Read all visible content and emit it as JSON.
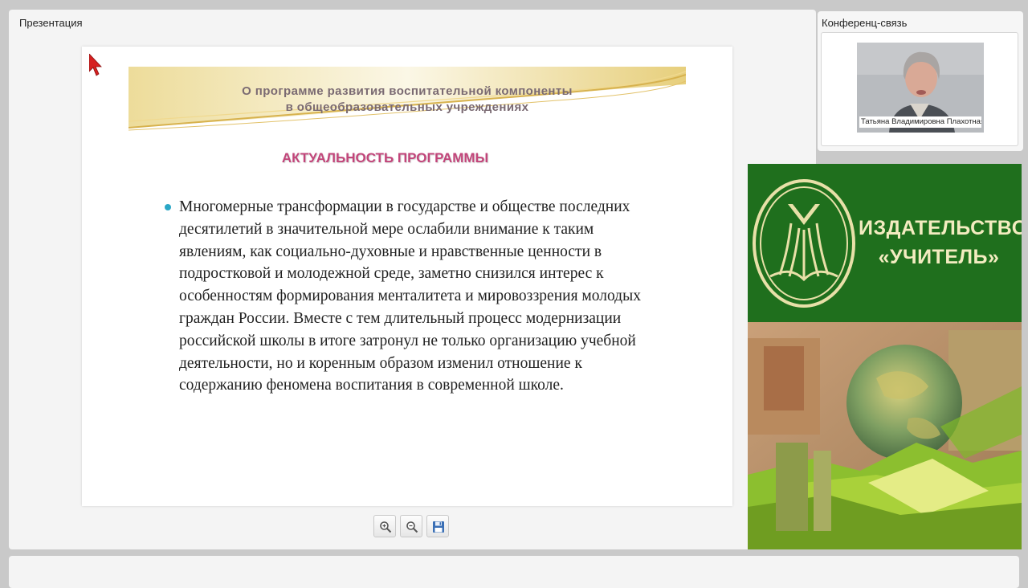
{
  "presentation": {
    "panel_title": "Презентация",
    "slide": {
      "banner_line1": "О программе развития воспитательной компоненты",
      "banner_line2": "в общеобразовательных учреждениях",
      "heading": "АКТУАЛЬНОСТЬ ПРОГРАММЫ",
      "body": "Многомерные трансформации в государстве и обществе последних десятилетий в значительной мере ослабили внимание к таким явлениям, как социально-духовные и нравственные ценности в подростковой и молодежной среде, заметно снизился интерес к особенностям формирования менталитета и мировоззрения молодых граждан России. Вместе с тем длительный процесс модернизации российской школы в итоге затронул не только организацию учебной деятельности, но и коренным образом изменил отношение к содержанию феномена воспитания в современной школе."
    },
    "tools": [
      "zoom-in-icon",
      "zoom-out-icon",
      "save-icon"
    ]
  },
  "conference": {
    "panel_title": "Конференц-связь",
    "participant_name": "Татьяна Владимировна Плахотная"
  },
  "promo": {
    "line1": "ИЗДАТЕЛЬСТВО",
    "line2": "«УЧИТЕЛЬ»"
  },
  "colors": {
    "heading": "#c2457a",
    "bullet": "#2aa7c6",
    "promo_green": "#1f6f1d",
    "promo_text": "#f3ecc0"
  }
}
